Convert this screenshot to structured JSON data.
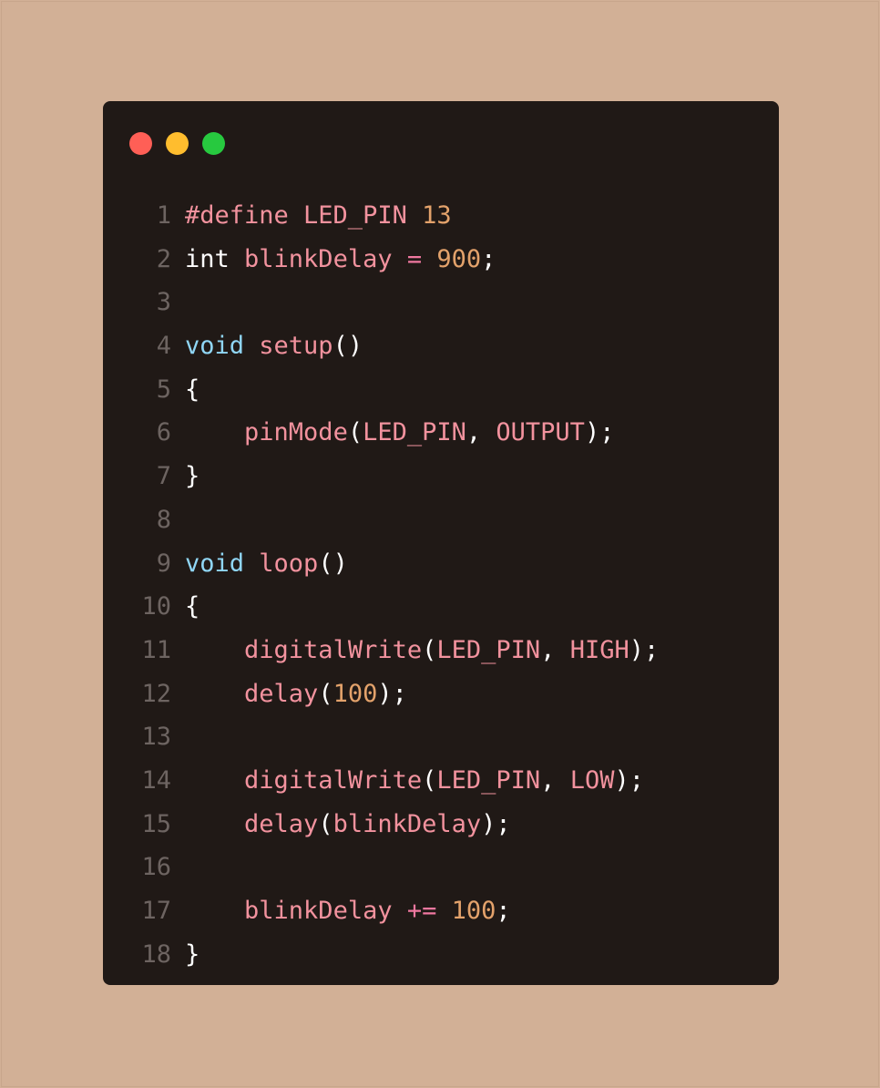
{
  "window": {
    "controls": {
      "close_color": "#ff5f56",
      "minimize_color": "#ffbd2e",
      "maximize_color": "#27c93f"
    }
  },
  "colors": {
    "background": "#d2b096",
    "editor_background": "#201916",
    "line_number": "#6d6461",
    "identifier": "#f2929e",
    "keyword": "#90d6f5",
    "number": "#e3a26b",
    "operator": "#f078a0",
    "plain": "#ffffff"
  },
  "code": {
    "lines": [
      {
        "n": "1",
        "tokens": [
          {
            "t": "#define LED_PIN ",
            "c": "pink"
          },
          {
            "t": "13",
            "c": "orange"
          }
        ]
      },
      {
        "n": "2",
        "tokens": [
          {
            "t": "int ",
            "c": "white"
          },
          {
            "t": "blinkDelay ",
            "c": "pink"
          },
          {
            "t": "= ",
            "c": "op"
          },
          {
            "t": "900",
            "c": "orange"
          },
          {
            "t": ";",
            "c": "white"
          }
        ]
      },
      {
        "n": "3",
        "tokens": []
      },
      {
        "n": "4",
        "tokens": [
          {
            "t": "void ",
            "c": "blue"
          },
          {
            "t": "setup",
            "c": "pink"
          },
          {
            "t": "()",
            "c": "white"
          }
        ]
      },
      {
        "n": "5",
        "tokens": [
          {
            "t": "{",
            "c": "white"
          }
        ]
      },
      {
        "n": "6",
        "tokens": [
          {
            "t": "    ",
            "c": "white"
          },
          {
            "t": "pinMode",
            "c": "pink"
          },
          {
            "t": "(",
            "c": "white"
          },
          {
            "t": "LED_PIN",
            "c": "pink"
          },
          {
            "t": ", ",
            "c": "white"
          },
          {
            "t": "OUTPUT",
            "c": "pink"
          },
          {
            "t": ");",
            "c": "white"
          }
        ]
      },
      {
        "n": "7",
        "tokens": [
          {
            "t": "}",
            "c": "white"
          }
        ]
      },
      {
        "n": "8",
        "tokens": []
      },
      {
        "n": "9",
        "tokens": [
          {
            "t": "void ",
            "c": "blue"
          },
          {
            "t": "loop",
            "c": "pink"
          },
          {
            "t": "()",
            "c": "white"
          }
        ]
      },
      {
        "n": "10",
        "tokens": [
          {
            "t": "{",
            "c": "white"
          }
        ]
      },
      {
        "n": "11",
        "tokens": [
          {
            "t": "    ",
            "c": "white"
          },
          {
            "t": "digitalWrite",
            "c": "pink"
          },
          {
            "t": "(",
            "c": "white"
          },
          {
            "t": "LED_PIN",
            "c": "pink"
          },
          {
            "t": ", ",
            "c": "white"
          },
          {
            "t": "HIGH",
            "c": "pink"
          },
          {
            "t": ");",
            "c": "white"
          }
        ]
      },
      {
        "n": "12",
        "tokens": [
          {
            "t": "    ",
            "c": "white"
          },
          {
            "t": "delay",
            "c": "pink"
          },
          {
            "t": "(",
            "c": "white"
          },
          {
            "t": "100",
            "c": "orange"
          },
          {
            "t": ");",
            "c": "white"
          }
        ]
      },
      {
        "n": "13",
        "tokens": []
      },
      {
        "n": "14",
        "tokens": [
          {
            "t": "    ",
            "c": "white"
          },
          {
            "t": "digitalWrite",
            "c": "pink"
          },
          {
            "t": "(",
            "c": "white"
          },
          {
            "t": "LED_PIN",
            "c": "pink"
          },
          {
            "t": ", ",
            "c": "white"
          },
          {
            "t": "LOW",
            "c": "pink"
          },
          {
            "t": ");",
            "c": "white"
          }
        ]
      },
      {
        "n": "15",
        "tokens": [
          {
            "t": "    ",
            "c": "white"
          },
          {
            "t": "delay",
            "c": "pink"
          },
          {
            "t": "(",
            "c": "white"
          },
          {
            "t": "blinkDelay",
            "c": "pink"
          },
          {
            "t": ");",
            "c": "white"
          }
        ]
      },
      {
        "n": "16",
        "tokens": []
      },
      {
        "n": "17",
        "tokens": [
          {
            "t": "    ",
            "c": "white"
          },
          {
            "t": "blinkDelay ",
            "c": "pink"
          },
          {
            "t": "+= ",
            "c": "op"
          },
          {
            "t": "100",
            "c": "orange"
          },
          {
            "t": ";",
            "c": "white"
          }
        ]
      },
      {
        "n": "18",
        "tokens": [
          {
            "t": "}",
            "c": "white"
          }
        ]
      }
    ]
  }
}
